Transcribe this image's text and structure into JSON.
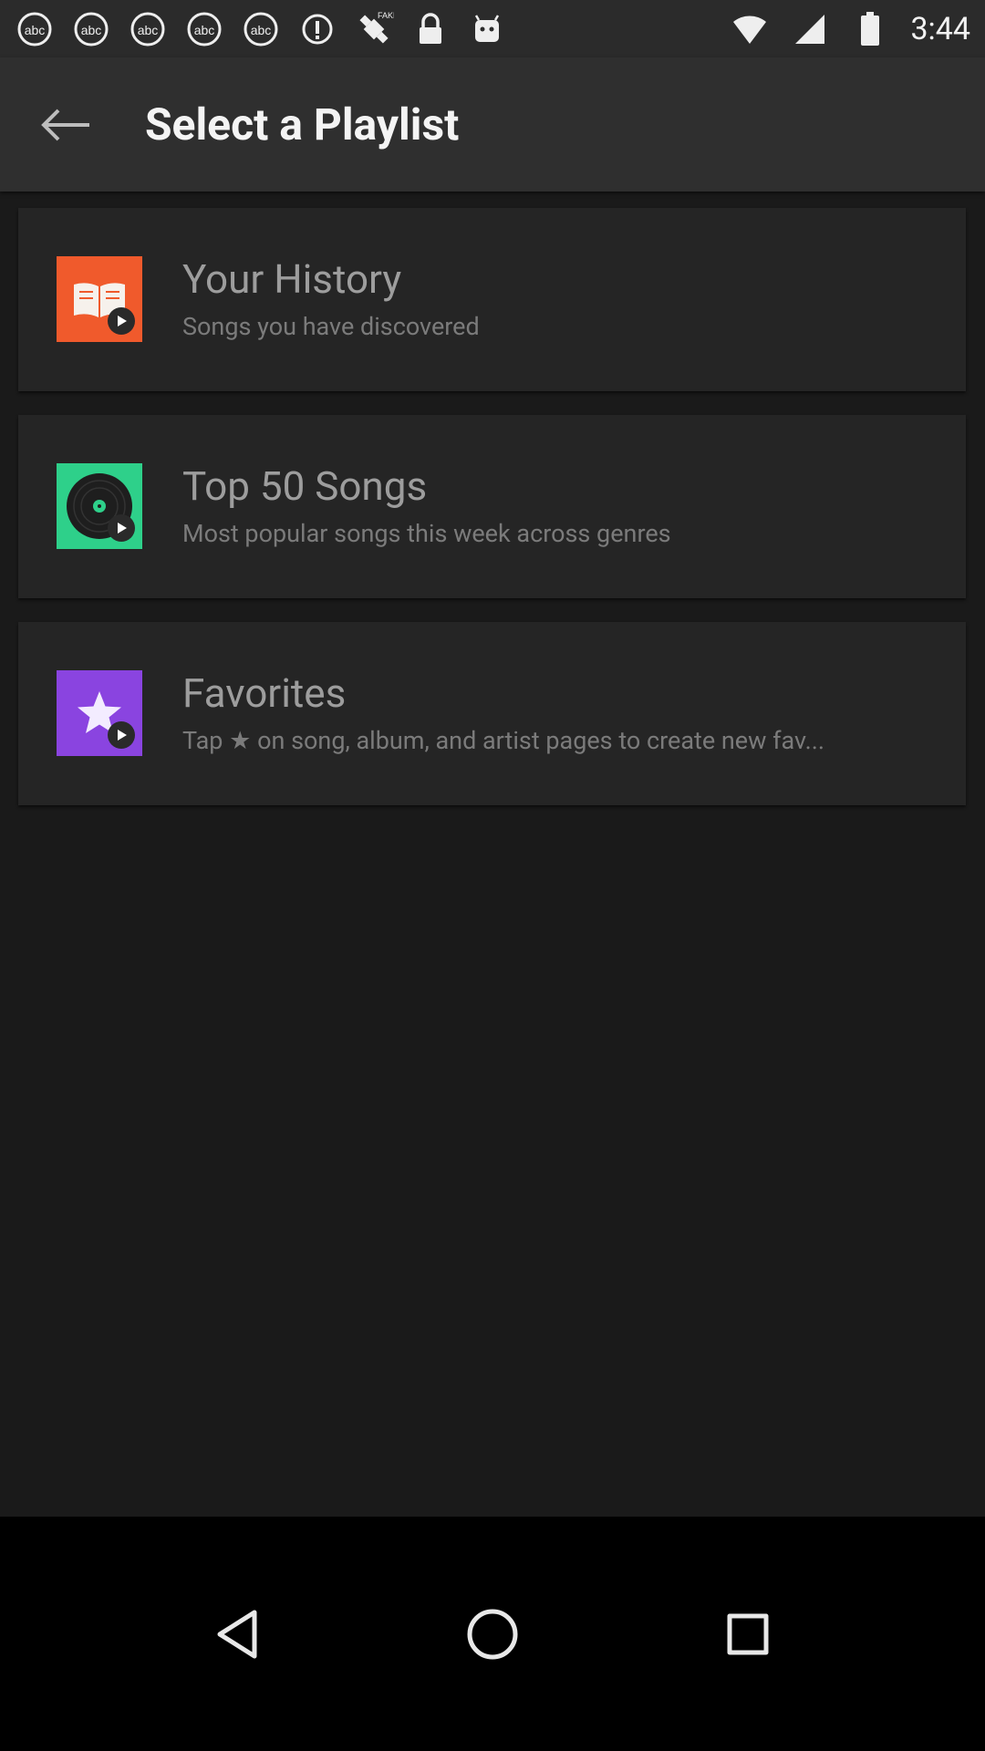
{
  "status_bar": {
    "time": "3:44",
    "icons": [
      "abc-news-icon",
      "abc-news-icon",
      "abc-news-icon",
      "abc-news-icon",
      "abc-news-icon",
      "info-icon",
      "fake-gps-icon",
      "lock-icon",
      "android-icon"
    ]
  },
  "app_bar": {
    "title": "Select a Playlist"
  },
  "playlists": [
    {
      "title": "Your History",
      "subtitle": "Songs you have discovered",
      "icon": "book-icon",
      "color": "#f05a2c"
    },
    {
      "title": "Top 50 Songs",
      "subtitle": "Most popular songs this week across genres",
      "icon": "vinyl-record-icon",
      "color": "#2ed08a"
    },
    {
      "title": "Favorites",
      "subtitle": "Tap ★ on song, album, and artist pages to create new fav...",
      "icon": "star-icon",
      "color": "#8a44e0"
    }
  ],
  "nav": [
    "back-triangle-icon",
    "home-circle-icon",
    "recents-square-icon"
  ]
}
